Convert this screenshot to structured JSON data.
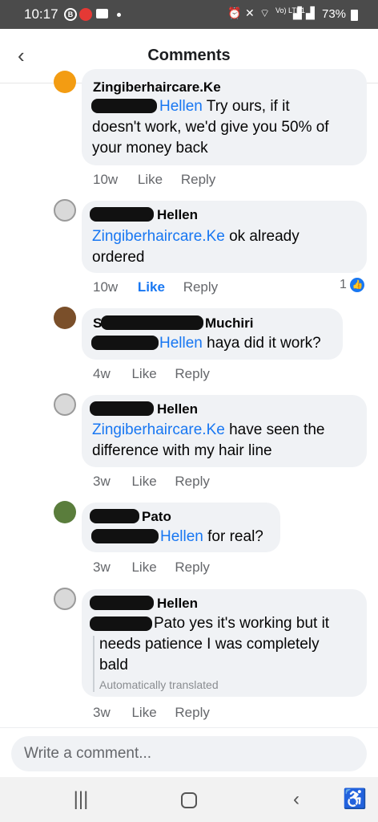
{
  "status_bar": {
    "time": "10:17",
    "b_badge": "B",
    "volte": "Vo)\nLTE1",
    "battery": "73%"
  },
  "header": {
    "title": "Comments",
    "back_icon": "chevron-left-icon"
  },
  "comments": [
    {
      "author": "Zingiberhaircare.Ke",
      "mention": "Hellen",
      "text_after_mention": " Try ours, if it",
      "line2": "doesn't work, we'd give you 50% of",
      "line3": "your money back",
      "time": "10w",
      "like": "Like",
      "reply": "Reply"
    },
    {
      "author": "Hellen",
      "mention": "Zingiberhaircare.Ke",
      "text_after_mention": " ok already",
      "line2": "ordered",
      "time": "10w",
      "like": "Like",
      "reply": "Reply",
      "reaction_count": "1"
    },
    {
      "author": "Muchiri",
      "author_prefix": "S",
      "mention": "Hellen",
      "text_after_mention": " haya did it work?",
      "time": "4w",
      "like": "Like",
      "reply": "Reply"
    },
    {
      "author": "Hellen",
      "mention": "Zingiberhaircare.Ke",
      "text_after_mention": " have seen the",
      "line2": "difference with my hair line",
      "time": "3w",
      "like": "Like",
      "reply": "Reply"
    },
    {
      "author": "Pato",
      "mention": "Hellen",
      "text_after_mention": " for real?",
      "time": "3w",
      "like": "Like",
      "reply": "Reply"
    },
    {
      "author": "Hellen",
      "mention": "Pato",
      "text_after_mention": " yes it's working but it",
      "line2": "needs patience I was completely",
      "line3": "bald",
      "translated_note": "Automatically translated",
      "time": "3w",
      "like": "Like",
      "reply": "Reply"
    }
  ],
  "composer": {
    "placeholder": "Write a comment..."
  },
  "nav": {
    "recents": "recents-icon",
    "home": "home-icon",
    "back": "back-icon",
    "accessibility": "accessibility-icon"
  },
  "colors": {
    "link": "#1877f2",
    "bubble": "#f0f2f5",
    "meta": "#65676b"
  }
}
